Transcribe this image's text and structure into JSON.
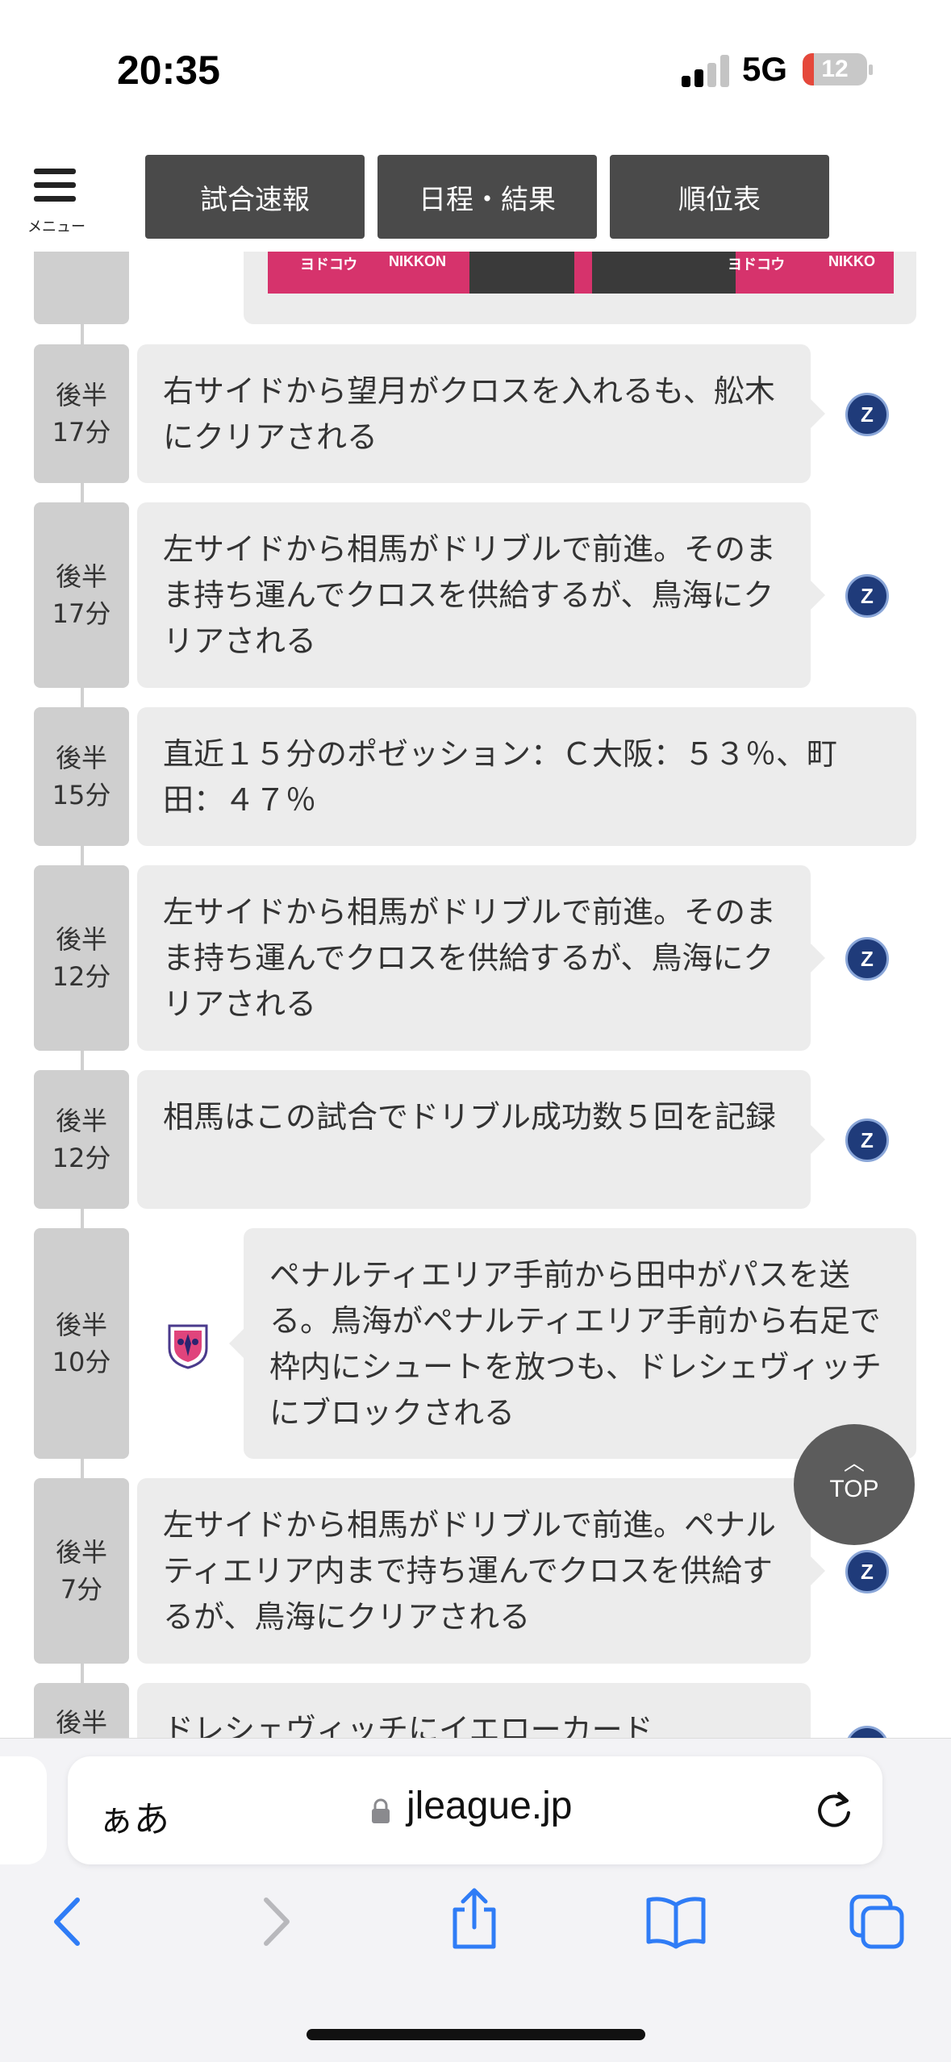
{
  "status_bar": {
    "time": "20:35",
    "network": "5G",
    "battery": "12"
  },
  "header": {
    "menu_label": "メニュー",
    "nav": [
      "試合速報",
      "日程・結果",
      "順位表"
    ]
  },
  "photo_texts": [
    "ヨドコウ",
    "NIKKON",
    "ヨドコウ",
    "NIKKO"
  ],
  "feed": [
    {
      "half": "後半",
      "minute": "17分",
      "text": "右サイドから望月がクロスを入れるも、舩木にクリアされる",
      "side": "away"
    },
    {
      "half": "後半",
      "minute": "17分",
      "text": "左サイドから相馬がドリブルで前進。そのまま持ち運んでクロスを供給するが、鳥海にクリアされる",
      "side": "away"
    },
    {
      "half": "後半",
      "minute": "15分",
      "text": "直近１５分のポゼッション：Ｃ大阪：５３％、町田：４７％",
      "side": "neutral"
    },
    {
      "half": "後半",
      "minute": "12分",
      "text": "左サイドから相馬がドリブルで前進。そのまま持ち運んでクロスを供給するが、鳥海にクリアされる",
      "side": "away"
    },
    {
      "half": "後半",
      "minute": "12分",
      "text": "相馬はこの試合でドリブル成功数５回を記録",
      "side": "away"
    },
    {
      "half": "後半",
      "minute": "10分",
      "text": "ペナルティエリア手前から田中がパスを送る。鳥海がペナルティエリア手前から右足で枠内にシュートを放つも、ドレシェヴィッチにブロックされる",
      "side": "home"
    },
    {
      "half": "後半",
      "minute": "7分",
      "text": "左サイドから相馬がドリブルで前進。ペナルティエリア内まで持ち運んでクロスを供給するが、鳥海にクリアされる",
      "side": "away"
    },
    {
      "half": "後半",
      "minute": "",
      "text": "ドレシェヴィッチにイエローカード",
      "side": "away"
    }
  ],
  "top_button": {
    "label": "TOP"
  },
  "browser": {
    "aa": "ぁあ",
    "url": "jleague.jp"
  },
  "colors": {
    "nav_bg": "#4a4a4a",
    "bubble": "#ececec",
    "timebox": "#cfcfcf",
    "ios_blue": "#2f7cf6"
  },
  "icons": [
    "menu-icon",
    "lock-icon",
    "reload-icon",
    "back-icon",
    "forward-icon",
    "share-icon",
    "bookmarks-icon",
    "tabs-icon",
    "machida-crest-icon",
    "cerezo-crest-icon"
  ]
}
